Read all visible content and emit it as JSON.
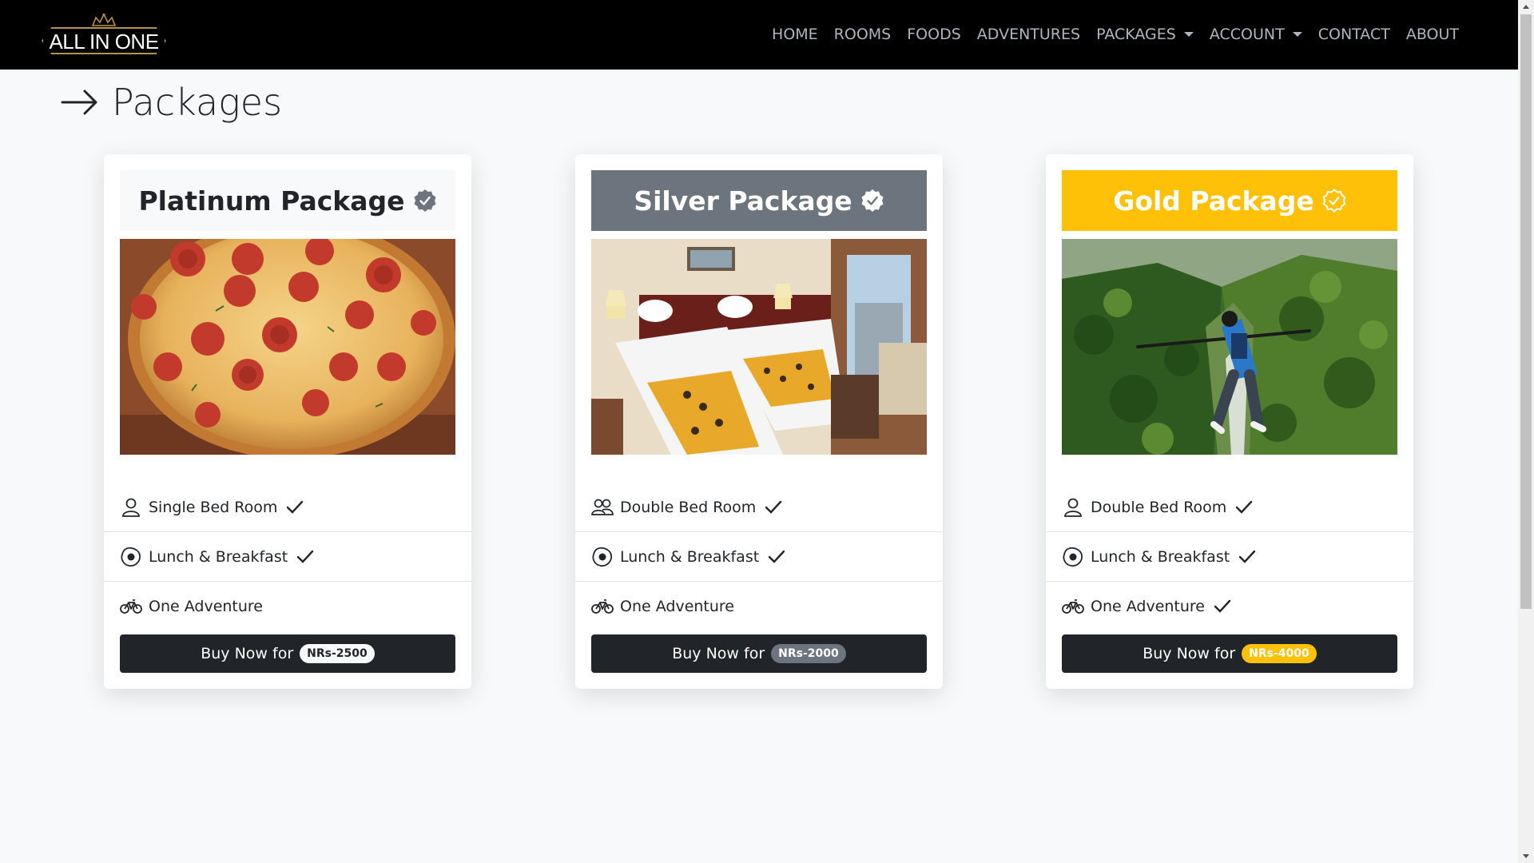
{
  "brand": {
    "logo_text": "ALL IN ONE"
  },
  "nav": {
    "items": [
      {
        "label": "HOME",
        "active": true,
        "dropdown": false
      },
      {
        "label": "ROOMS",
        "active": false,
        "dropdown": false
      },
      {
        "label": "FOODS",
        "active": false,
        "dropdown": false
      },
      {
        "label": "ADVENTURES",
        "active": false,
        "dropdown": false
      },
      {
        "label": "PACKAGES",
        "active": false,
        "dropdown": true
      },
      {
        "label": "ACCOUNT",
        "active": false,
        "dropdown": true
      },
      {
        "label": "CONTACT",
        "active": false,
        "dropdown": false
      },
      {
        "label": "ABOUT",
        "active": false,
        "dropdown": false
      }
    ]
  },
  "page": {
    "title": "Packages",
    "title_icon": "arrow-right-icon"
  },
  "packages": [
    {
      "title": "Platinum Package",
      "header_bg": "#f8f9fa",
      "header_color": "#212529",
      "badge_icon": "verified-filled-icon",
      "badge_icon_color": "#6c757d",
      "image": "pizza-image",
      "features": [
        {
          "icon": "person-icon",
          "label": "Single Bed Room",
          "checked": true
        },
        {
          "icon": "egg-fried-icon",
          "label": "Lunch & Breakfast",
          "checked": true
        },
        {
          "icon": "bicycle-icon",
          "label": "One Adventure",
          "checked": false
        }
      ],
      "buy_label": "Buy Now for",
      "price": "NRs-2500",
      "price_bg": "#f8f9fa",
      "price_color": "#212529"
    },
    {
      "title": "Silver Package",
      "header_bg": "#6c757d",
      "header_color": "#ffffff",
      "badge_icon": "verified-filled-icon",
      "badge_icon_color": "#ffffff",
      "image": "hotel-room-image",
      "features": [
        {
          "icon": "people-icon",
          "label": "Double Bed Room",
          "checked": true
        },
        {
          "icon": "egg-fried-icon",
          "label": "Lunch & Breakfast",
          "checked": true
        },
        {
          "icon": "bicycle-icon",
          "label": "One Adventure",
          "checked": false
        }
      ],
      "buy_label": "Buy Now for",
      "price": "NRs-2000",
      "price_bg": "#6c757d",
      "price_color": "#ffffff"
    },
    {
      "title": "Gold Package",
      "header_bg": "#ffc107",
      "header_color": "#ffffff",
      "badge_icon": "verified-outline-icon",
      "badge_icon_color": "#ffffff",
      "image": "bungee-jump-image",
      "features": [
        {
          "icon": "person-icon",
          "label": "Double Bed Room",
          "checked": true
        },
        {
          "icon": "egg-fried-icon",
          "label": "Lunch & Breakfast",
          "checked": true
        },
        {
          "icon": "bicycle-icon",
          "label": "One Adventure",
          "checked": true
        }
      ],
      "buy_label": "Buy Now for",
      "price": "NRs-4000",
      "price_bg": "#ffc107",
      "price_color": "#ffffff"
    }
  ]
}
